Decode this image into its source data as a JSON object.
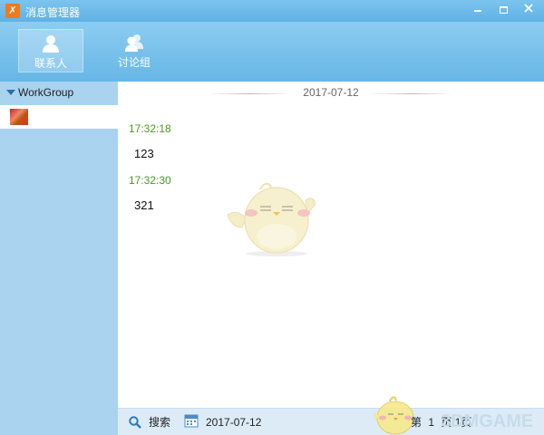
{
  "window": {
    "title": "消息管理器",
    "app_icon_glyph": "✗"
  },
  "toolbar": {
    "contacts_label": "联系人",
    "groups_label": "讨论组"
  },
  "sidebar": {
    "group_name": "WorkGroup"
  },
  "conversation": {
    "date_header": "2017-07-12",
    "messages": [
      {
        "time": "17:32:18",
        "text": "123"
      },
      {
        "time": "17:32:30",
        "text": "321"
      }
    ]
  },
  "bottom": {
    "search_label": "搜索",
    "date_value": "2017-07-12",
    "page_prefix": "第",
    "page_current": "1",
    "page_suffix": "页/1页"
  },
  "watermark": {
    "text": "3DMGAME"
  },
  "colors": {
    "accent": "#67b6e6",
    "sidebar_bg": "#a9d3ee",
    "timestamp": "#4a9a22",
    "bottom_bg": "#dcebf6"
  }
}
